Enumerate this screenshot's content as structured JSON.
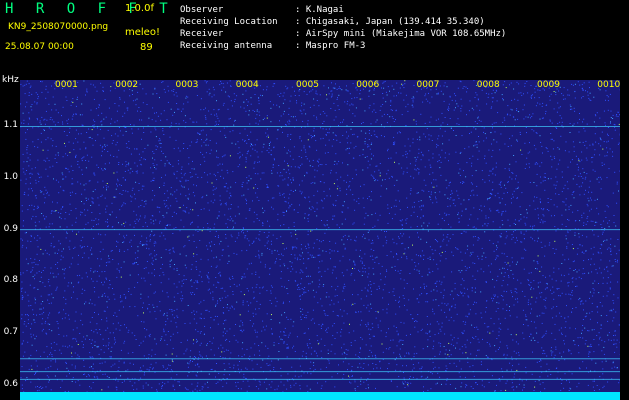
{
  "header": {
    "app_title": "H R O F F T",
    "version": "1.0.0f",
    "filename": "KN9_2508070000.png",
    "mode": "meleo!",
    "datetime": "25.08.07 00:00",
    "count": "89"
  },
  "info": [
    {
      "label": "Observer",
      "value": "K.Nagai"
    },
    {
      "label": "Receiving Location",
      "value": "Chigasaki, Japan (139.414 35.340)"
    },
    {
      "label": "Receiver",
      "value": "AirSpy mini (Miakejima VOR 108.65MHz)"
    },
    {
      "label": "Receiving antenna",
      "value": "Maspro FM-3"
    }
  ],
  "spectrogram": {
    "y_unit": "kHz",
    "y_ticks": [
      "1.1",
      "1.0",
      "0.9",
      "0.8",
      "0.7",
      "0.6"
    ],
    "y_range": [
      0.57,
      1.19
    ],
    "x_ticks": [
      "0001",
      "0002",
      "0003",
      "0004",
      "0005",
      "0006",
      "0007",
      "0008",
      "0009",
      "0010"
    ],
    "horizontal_lines_khz": [
      1.1,
      0.9,
      0.65,
      0.625,
      0.61
    ],
    "colors": {
      "background": "#1a1a7a",
      "speckle": "#2f4fff",
      "line": "#40d0ff",
      "bottom_band": "#00e5ff"
    }
  }
}
